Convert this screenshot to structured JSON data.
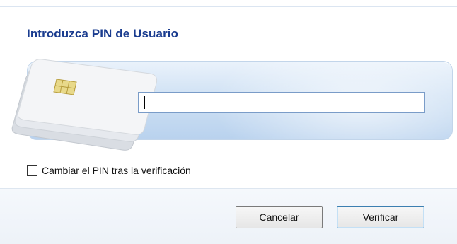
{
  "dialog": {
    "title": "Introduzca PIN de Usuario"
  },
  "pin_field": {
    "value": "",
    "placeholder": ""
  },
  "options": {
    "change_pin_label": "Cambiar el PIN tras la verificación",
    "change_pin_checked": false
  },
  "buttons": {
    "cancel_label": "Cancelar",
    "verify_label": "Verificar"
  },
  "icons": {
    "banner_art": "smart-card-stack-icon",
    "chip": "card-chip-icon"
  },
  "colors": {
    "title": "#1a3c8f",
    "banner_light": "#eaf2fb",
    "banner_dark": "#b9d2ee",
    "input_border": "#7a9cc8",
    "default_button_border": "#3c7fb1"
  }
}
